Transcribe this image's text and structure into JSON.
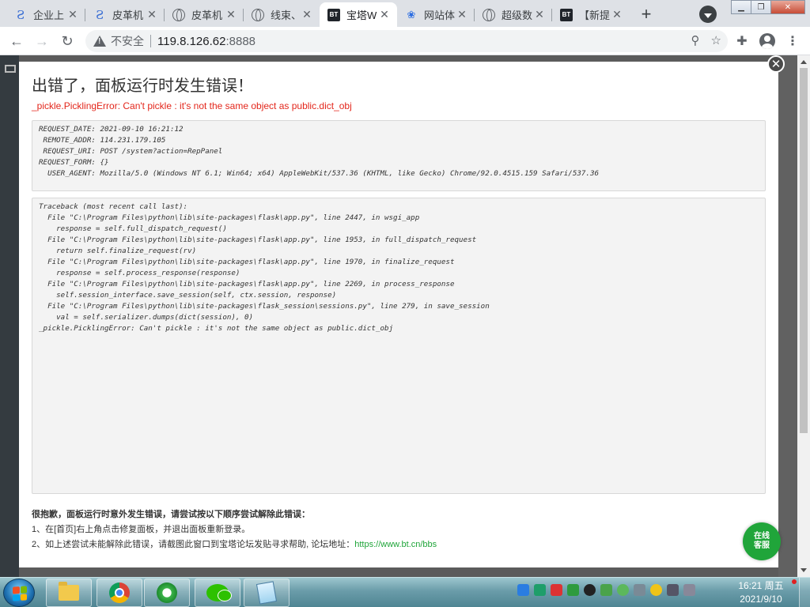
{
  "browser": {
    "tabs": [
      {
        "title": "企业上",
        "favicon": "s-logo-icon",
        "active": false
      },
      {
        "title": "皮革机",
        "favicon": "s-logo-icon",
        "active": false
      },
      {
        "title": "皮革机",
        "favicon": "globe-icon",
        "active": false
      },
      {
        "title": "线束、",
        "favicon": "globe-icon",
        "active": false
      },
      {
        "title": "宝塔W",
        "favicon": "bt-icon",
        "active": true
      },
      {
        "title": "网站体",
        "favicon": "paw-icon",
        "active": false
      },
      {
        "title": "超级数",
        "favicon": "globe-icon",
        "active": false
      },
      {
        "title": "【新提",
        "favicon": "bt-icon",
        "active": false
      }
    ],
    "bt_favicon_text": "BT",
    "security_label": "不安全",
    "url_host": "119.8.126.62",
    "url_port": ":8888"
  },
  "dialog": {
    "title": "出错了，面板运行时发生错误！",
    "error_line": "_pickle.PicklingError: Can't pickle : it's not the same object as public.dict_obj",
    "request_info": [
      "REQUEST_DATE: 2021-09-10 16:21:12",
      " REMOTE_ADDR: 114.231.179.105",
      " REQUEST_URI: POST /system?action=RepPanel",
      "REQUEST_FORM: {}",
      "  USER_AGENT: Mozilla/5.0 (Windows NT 6.1; Win64; x64) AppleWebKit/537.36 (KHTML, like Gecko) Chrome/92.0.4515.159 Safari/537.36"
    ],
    "traceback": [
      "Traceback (most recent call last):",
      "  File \"C:\\Program Files\\python\\lib\\site-packages\\flask\\app.py\", line 2447, in wsgi_app",
      "    response = self.full_dispatch_request()",
      "  File \"C:\\Program Files\\python\\lib\\site-packages\\flask\\app.py\", line 1953, in full_dispatch_request",
      "    return self.finalize_request(rv)",
      "  File \"C:\\Program Files\\python\\lib\\site-packages\\flask\\app.py\", line 1970, in finalize_request",
      "    response = self.process_response(response)",
      "  File \"C:\\Program Files\\python\\lib\\site-packages\\flask\\app.py\", line 2269, in process_response",
      "    self.session_interface.save_session(self, ctx.session, response)",
      "  File \"C:\\Program Files\\python\\lib\\site-packages\\flask_session\\sessions.py\", line 279, in save_session",
      "    val = self.serializer.dumps(dict(session), 0)",
      "_pickle.PicklingError: Can't pickle : it's not the same object as public.dict_obj"
    ],
    "help_heading": "很抱歉，面板运行时意外发生错误，请尝试按以下顺序尝试解除此错误：",
    "help_step1": "1、在[首页]右上角点击修复面板，并退出面板重新登录。",
    "help_step2": "2、如上述尝试未能解除此错误，请截图此窗口到宝塔论坛发贴寻求帮助, 论坛地址：",
    "forum_link": "https://www.bt.cn/bbs"
  },
  "support": {
    "line1": "在线",
    "line2": "客服"
  },
  "taskbar": {
    "apps": [
      "folder-icon",
      "chrome-icon",
      "ie-icon",
      "wechat-icon",
      "notepad-icon"
    ],
    "clock_time": "16:21 周五",
    "clock_date": "2021/9/10"
  },
  "colors": {
    "error_red": "#e3261b",
    "bt_green": "#20a53a",
    "link_green": "#20a53a"
  }
}
